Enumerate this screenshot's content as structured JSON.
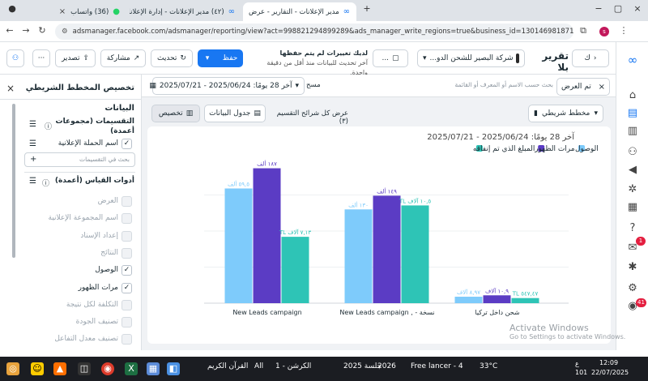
{
  "browser": {
    "tabs": [
      {
        "label": "مدير الإعلانات - التقارير - عرض",
        "active": true
      },
      {
        "label": "(٤٢) مدير الإعلانات - إدارة الإعلانات",
        "active": false
      },
      {
        "label": "(36) واتساب",
        "active": false
      }
    ],
    "url": "adsmanager.facebook.com/adsmanager/reporting/view?act=998821294899289&ads_manager_write_regions=true&business_id=130146981871154&eve..."
  },
  "toolbar": {
    "report_title": "تقرير بلا",
    "account_name": "شركة البصير للشحن الدو...",
    "unsaved_line1": "لديك تغييرات لم يتم حفظها",
    "unsaved_line2": "آخر تحديث للبيانات منذ أقل من دقيقة واحدة.",
    "save_label": "حفظ",
    "refresh_label": "تحديث",
    "share_label": "مشاركة",
    "export_label": "تصدير"
  },
  "view": {
    "search_placeholder": "بحث حسب الاسم أو المعرف أو القائمة",
    "tag_label": "تم العرض",
    "date_range": "آخر 28 يومًا: 2025/06/24 - 2025/07/21",
    "clear_label": "مسح",
    "breakdown_text": "عرض كل شرائح التقسيم (٣)",
    "data_table_label": "جدول البيانات",
    "customize_label": "تخصيص",
    "chart_type_label": "مخطط شريطي"
  },
  "left_panel": {
    "title": "تخصيص المخطط الشريطي",
    "data_heading": "البيانات",
    "breakdowns_heading": "التقسيمات (مجموعات أعمدة)",
    "breakdown_item": "اسم الحملة الإعلانية",
    "breakdown_search": "بحث في التقسيمات",
    "metrics_heading": "أدوات القياس (أعمدة)",
    "metrics": [
      {
        "label": "العرض",
        "checked": false,
        "disabled": true
      },
      {
        "label": "اسم المجموعة الإعلانية",
        "checked": false,
        "disabled": true
      },
      {
        "label": "إعداد الإسناد",
        "checked": false,
        "disabled": true
      },
      {
        "label": "النتائج",
        "checked": false,
        "disabled": true
      },
      {
        "label": "الوصول",
        "checked": true,
        "disabled": false
      },
      {
        "label": "مرات الظهور",
        "checked": true,
        "disabled": false
      },
      {
        "label": "التكلفة لكل نتيجة",
        "checked": false,
        "disabled": true
      },
      {
        "label": "تصنيف الجودة",
        "checked": false,
        "disabled": true
      },
      {
        "label": "تصنيف معدل التفاعل",
        "checked": false,
        "disabled": true
      }
    ]
  },
  "chart_data": {
    "type": "bar",
    "title": "آخر 28 يومًا: 2025/06/24 - 2025/07/21",
    "categories": [
      "New Leads campaign",
      "New Leads campaign , - نسخة",
      "شحن داخل تركيا"
    ],
    "series": [
      {
        "name": "المبلغ الذي تم إنفاقه",
        "color": "#2ec4b6",
        "values": [
          7.13,
          10.5,
          0.54747
        ],
        "labels": [
          "TL ٧,١٣ آلاف",
          "TL ١٠,٥ آلاف",
          "TL ٥٤٧,٤٧"
        ]
      },
      {
        "name": "مرات الظهور",
        "color": "#5b3cc4",
        "values": [
          187,
          149,
          10.9
        ],
        "labels": [
          "١٨٧ ألف",
          "١٤٩ ألف",
          "١٠,٩ آلاف"
        ]
      },
      {
        "name": "الوصول",
        "color": "#7ecbfb",
        "values": [
          159,
          130,
          8.97
        ],
        "labels": [
          "٥٩,٥ ألف",
          "١٣٠ ألف",
          "٨,٩٧ آلاف"
        ]
      }
    ],
    "legend_position": "top-right",
    "grid": true
  },
  "rail_icons": [
    "meta-logo-icon",
    "home-icon",
    "chart-icon",
    "campaign-icon",
    "audience-icon",
    "megaphone-icon",
    "settings-network-icon",
    "grid-icon",
    "help-icon",
    "notification-icon",
    "bug-icon",
    "gear-icon",
    "alert-icon"
  ],
  "rail_badges": {
    "notification": "1",
    "alert": "41"
  },
  "watermark": {
    "line1": "Activate Windows",
    "line2": "Go to Settings to activate Windows."
  },
  "taskbar": {
    "items": [
      "القرآن الكريم",
      "All",
      "الكرشن - 1",
      "جلسة 2025",
      "2026",
      "4 - Free lancer"
    ],
    "weather": "33°C",
    "time": "12:09",
    "date": "22/07/2025",
    "lang": "ع",
    "vol": "101"
  }
}
